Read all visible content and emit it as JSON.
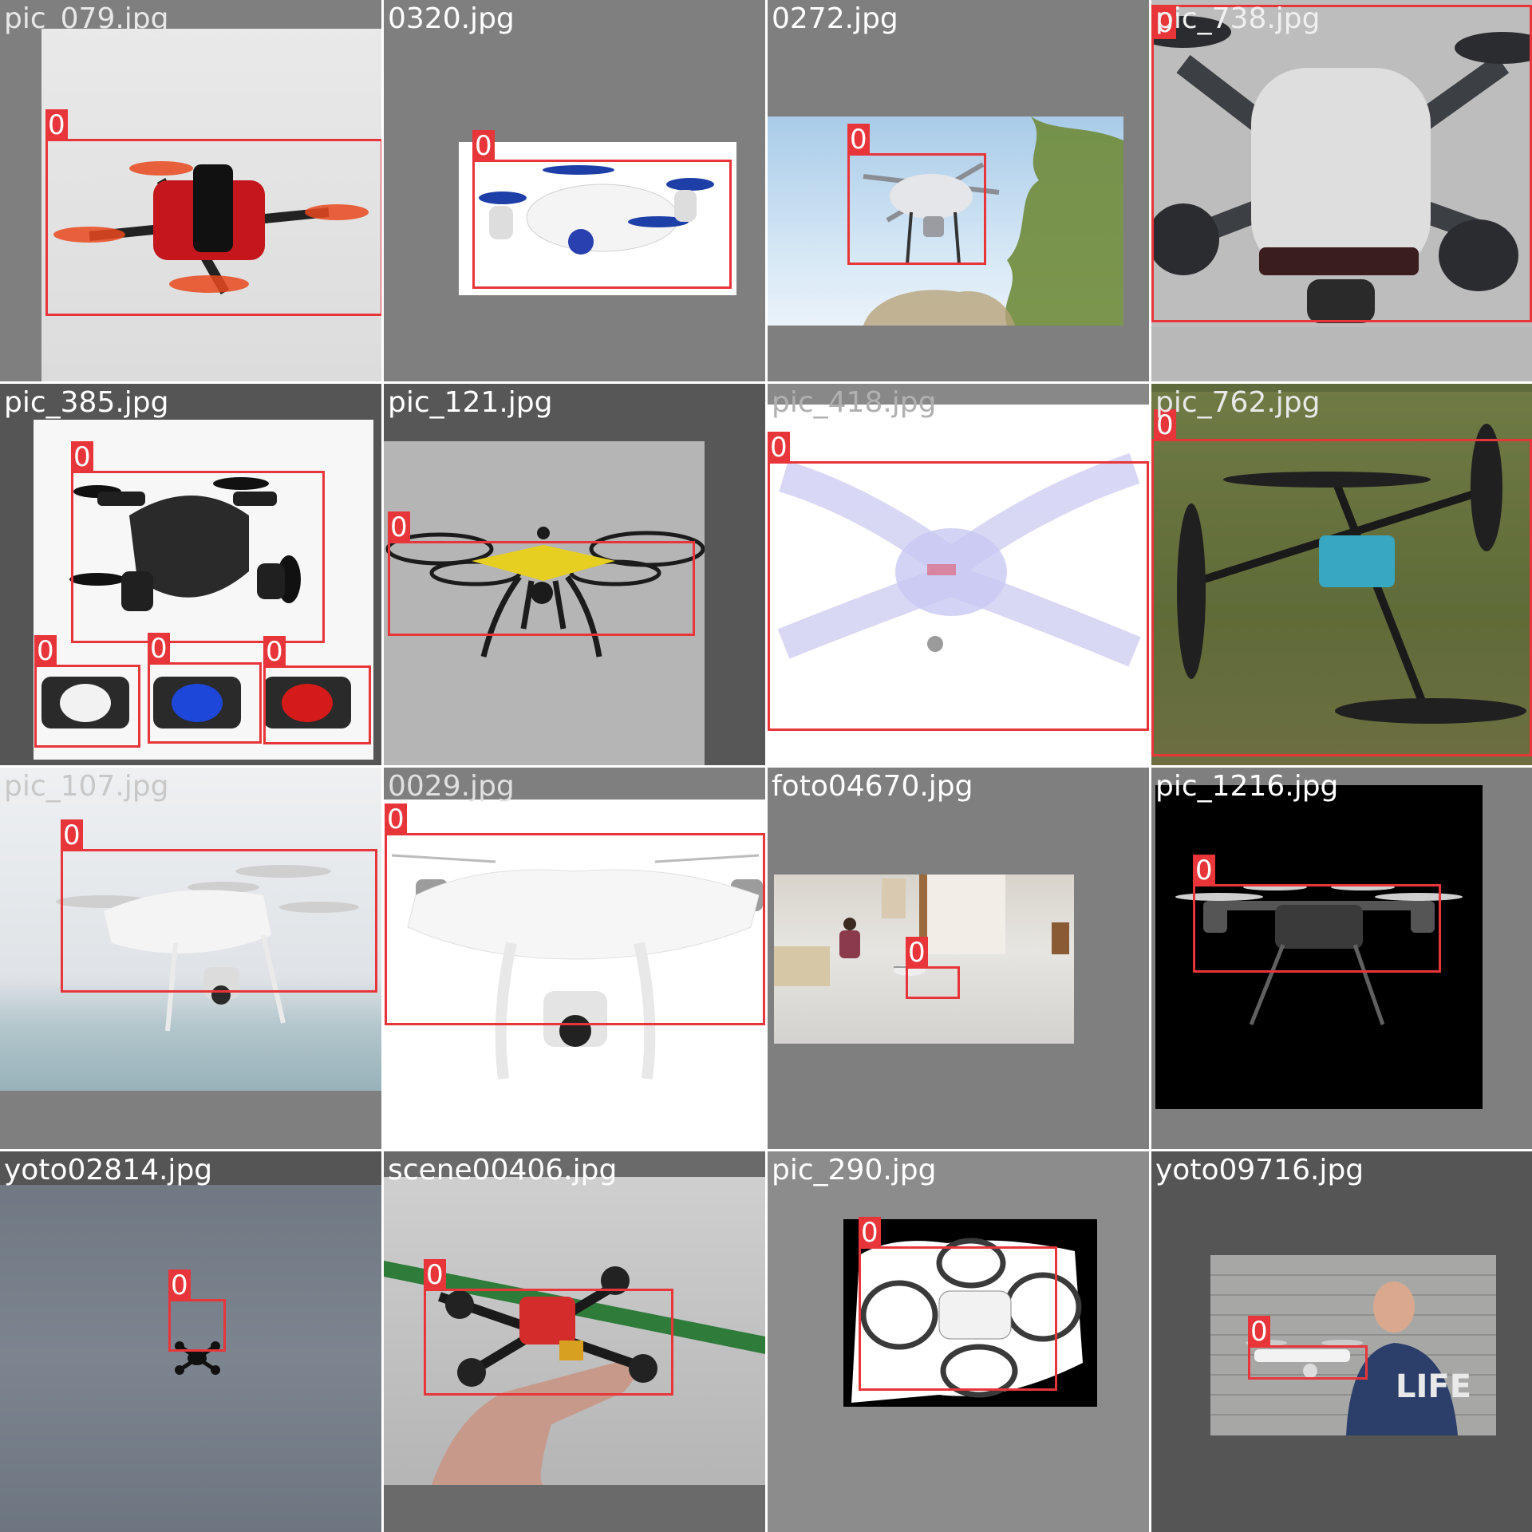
{
  "colors": {
    "box": "#e8353a",
    "label_text": "#ffffff",
    "gap": "#ffffff"
  },
  "tiles": [
    {
      "filename": "pic_079.jpg",
      "text_color": "#e8e8e8",
      "bg": "#7f7f7f",
      "photo_bg": "linear-gradient(#e9e9e9,#dcdcdc)",
      "drone": {
        "body": "#c4161c",
        "arm": "#222222",
        "prop": "#e8491d"
      },
      "boxes": [
        {
          "label": "0"
        }
      ]
    },
    {
      "filename": "0320.jpg",
      "text_color": "#ffffff",
      "bg": "#7f7f7f",
      "photo_bg": "#ffffff",
      "drone": {
        "body": "#f4f4f4",
        "arm": "#dddddd",
        "prop": "#1f3fa8"
      },
      "boxes": [
        {
          "label": "0"
        }
      ]
    },
    {
      "filename": "0272.jpg",
      "text_color": "#ffffff",
      "bg": "#7f7f7f",
      "photo_bg": "linear-gradient(180deg,#a9cbe8 0%,#d8e9f6 70%,#eaf2f9 100%)",
      "drone": {
        "body": "#e4e6ea",
        "arm": "#8a8d93",
        "prop": "#5a5d63"
      },
      "boxes": [
        {
          "label": "0"
        }
      ]
    },
    {
      "filename": "pic_738.jpg",
      "text_color": "#f0f0f0",
      "bg": "#b8b8b8",
      "photo_bg": "#bdbdbd",
      "drone": {
        "body": "#dedede",
        "arm": "#3c3f44",
        "prop": "#2a2c30"
      },
      "boxes": [
        {
          "label": "0"
        }
      ]
    },
    {
      "filename": "pic_385.jpg",
      "text_color": "#ffffff",
      "bg": "#555555",
      "photo_bg": "#f7f7f7",
      "drone": {
        "body": "#2a2a2a",
        "arm": "#202020",
        "prop": "#111111"
      },
      "small_colors": [
        "#f2f2f2",
        "#1c47d8",
        "#d51a1a"
      ],
      "boxes": [
        {
          "label": "0"
        },
        {
          "label": "0"
        },
        {
          "label": "0"
        },
        {
          "label": "0"
        }
      ]
    },
    {
      "filename": "pic_121.jpg",
      "text_color": "#ffffff",
      "bg": "#575757",
      "photo_bg": "#b5b5b5",
      "drone": {
        "body": "#e6cf20",
        "arm": "#1b1b1b",
        "prop": "#1b1b1b"
      },
      "boxes": [
        {
          "label": "0"
        }
      ]
    },
    {
      "filename": "pic_418.jpg",
      "text_color": "#b0b0b0",
      "bg": "#888888",
      "photo_bg": "#ffffff",
      "drone": {
        "body": "#c8c8f2",
        "arm": "#c8c8f2",
        "prop": "#c8c8f2"
      },
      "boxes": [
        {
          "label": "0"
        }
      ]
    },
    {
      "filename": "pic_762.jpg",
      "text_color": "#e8e8e8",
      "bg": "#5e6a3c",
      "photo_bg": "linear-gradient(180deg,#6f7a45 0%,#5f6b38 60%,#6d6f40 100%)",
      "drone": {
        "body": "#38a7c2",
        "arm": "#1a1a1a",
        "prop": "#202020"
      },
      "boxes": [
        {
          "label": "0"
        }
      ]
    },
    {
      "filename": "pic_107.jpg",
      "text_color": "#c8c8c8",
      "bg": "#7f7f7f",
      "photo_bg": "linear-gradient(180deg,#eef0f2 0%,#dfe3e7 65%,#b3c6cc 80%,#98b2ba 100%)",
      "drone": {
        "body": "#f4f4f4",
        "arm": "#e0e0e0",
        "prop": "#cfcfcf"
      },
      "boxes": [
        {
          "label": "0"
        }
      ]
    },
    {
      "filename": "0029.jpg",
      "text_color": "#e0e0e0",
      "bg": "#7f7f7f",
      "photo_bg": "#ffffff",
      "drone": {
        "body": "#f6f6f6",
        "arm": "#e8e8e8",
        "prop": "#dddddd"
      },
      "boxes": [
        {
          "label": "0"
        }
      ]
    },
    {
      "filename": "foto04670.jpg",
      "text_color": "#ffffff",
      "bg": "#7f7f7f",
      "photo_bg": "linear-gradient(180deg,#d8d4cc 0%,#e7e5e1 45%,#d4d2cf 100%)",
      "drone": {
        "body": "#eeeeee",
        "arm": "#9a9a9a",
        "prop": "#777777"
      },
      "boxes": [
        {
          "label": "0"
        }
      ]
    },
    {
      "filename": "pic_1216.jpg",
      "text_color": "#ffffff",
      "bg": "#7f7f7f",
      "photo_bg": "#000000",
      "drone": {
        "body": "#3a3a3a",
        "arm": "#555555",
        "prop": "#cfcfcf"
      },
      "boxes": [
        {
          "label": "0"
        }
      ]
    },
    {
      "filename": "yoto02814.jpg",
      "text_color": "#ffffff",
      "bg": "#555555",
      "photo_bg": "linear-gradient(180deg,#707983 0%,#7c858f 50%,#6d7680 100%)",
      "drone": {
        "body": "#111111",
        "arm": "#111111",
        "prop": "#111111"
      },
      "boxes": [
        {
          "label": "0"
        }
      ]
    },
    {
      "filename": "scene00406.jpg",
      "text_color": "#ffffff",
      "bg": "#6a6a6a",
      "photo_bg": "linear-gradient(180deg,#cfcfcf 0%,#b5b5b5 100%)",
      "drone": {
        "body": "#d42b2b",
        "arm": "#1a1a1a",
        "prop": "#222222"
      },
      "boxes": [
        {
          "label": "0"
        }
      ]
    },
    {
      "filename": "pic_290.jpg",
      "text_color": "#ffffff",
      "bg": "#8c8c8c",
      "photo_bg": "#000000",
      "drone": {
        "body": "#f2f2f2",
        "arm": "#505050",
        "prop": "#3a3a3a"
      },
      "boxes": [
        {
          "label": "0"
        }
      ]
    },
    {
      "filename": "yoto09716.jpg",
      "text_color": "#ffffff",
      "bg": "#555555",
      "photo_bg": "#a7a8a6",
      "drone": {
        "body": "#f2f2f2",
        "arm": "#e0e0e0",
        "prop": "#cccccc"
      },
      "shirt_text": "LIFE",
      "boxes": [
        {
          "label": "0"
        }
      ]
    }
  ]
}
